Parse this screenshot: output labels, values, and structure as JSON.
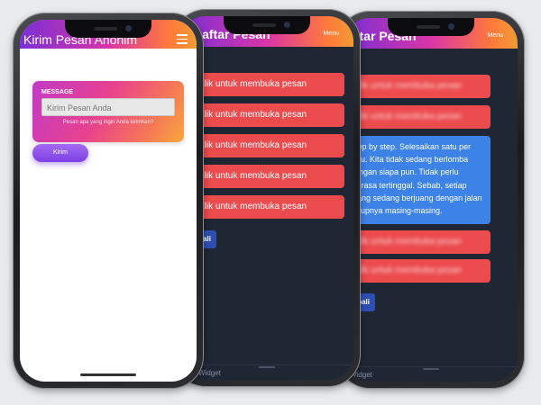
{
  "phone1": {
    "header_title": "Kirim Pesan Anonim",
    "card_label": "MESSAGE",
    "input_placeholder": "Kirim Pesan Anda",
    "hint": "Pesan apa yang ingin Anda kirimkan?",
    "send_label": "Kirim",
    "menu_icon": "hamburger-icon"
  },
  "phone2": {
    "header_title": "Daftar Pesan",
    "menu_label": "Menu",
    "items": [
      "Klik untuk membuka pesan",
      "Klik untuk membuka pesan",
      "Klik untuk membuka pesan",
      "Klik untuk membuka pesan",
      "Klik untuk membuka pesan"
    ],
    "back_label": "Kembali",
    "footer_label": "Widget"
  },
  "phone3": {
    "header_title": "Daftar Pesan",
    "menu_label": "Menu",
    "blurred_items": [
      "Klik untuk membuka pesan",
      "Klik untuk membuka pesan",
      "Klik untuk membuka pesan",
      "Klik untuk membuka pesan"
    ],
    "opened_message": "Step by step. Selesaikan satu per satu. Kita tidak sedang berlomba dengan siapa pun. Tidak perlu merasa tertinggal. Sebab, setiap orang sedang berjuang dengan jalan hidupnya masing-masing.",
    "back_label": "Kembali",
    "footer_label": "Widget"
  },
  "colors": {
    "message_red": "#ec4b4e",
    "opened_blue": "#3d82e6",
    "back_blue": "#2e4fb2",
    "dark_bg": "#1f2735"
  }
}
